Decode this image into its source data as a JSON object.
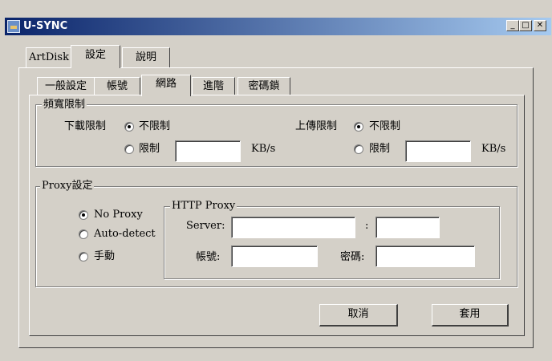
{
  "window": {
    "title": "U-SYNC"
  },
  "titlebar_buttons": {
    "minimize": "_",
    "maximize": "□",
    "close": "✕"
  },
  "outer_tabs": [
    "ArtDisk",
    "設定",
    "說明"
  ],
  "inner_tabs": [
    "一般設定",
    "帳號",
    "網路",
    "進階",
    "密碼鎖"
  ],
  "bandwidth": {
    "legend": "頻寬限制",
    "download": {
      "label": "下載限制",
      "option_unlimited": "不限制",
      "option_limit": "限制",
      "value": "",
      "unit": "KB/s",
      "selected": "unlimited"
    },
    "upload": {
      "label": "上傳限制",
      "option_unlimited": "不限制",
      "option_limit": "限制",
      "value": "",
      "unit": "KB/s",
      "selected": "unlimited"
    }
  },
  "proxy": {
    "legend": "Proxy設定",
    "options": [
      "No Proxy",
      "Auto-detect",
      "手動"
    ],
    "selected": "No Proxy",
    "http": {
      "legend": "HTTP Proxy",
      "server_label": "Server:",
      "server_value": "",
      "colon": ":",
      "port_value": "",
      "account_label": "帳號:",
      "account_value": "",
      "password_label": "密碼:",
      "password_value": ""
    }
  },
  "buttons": {
    "cancel": "取消",
    "apply": "套用"
  }
}
